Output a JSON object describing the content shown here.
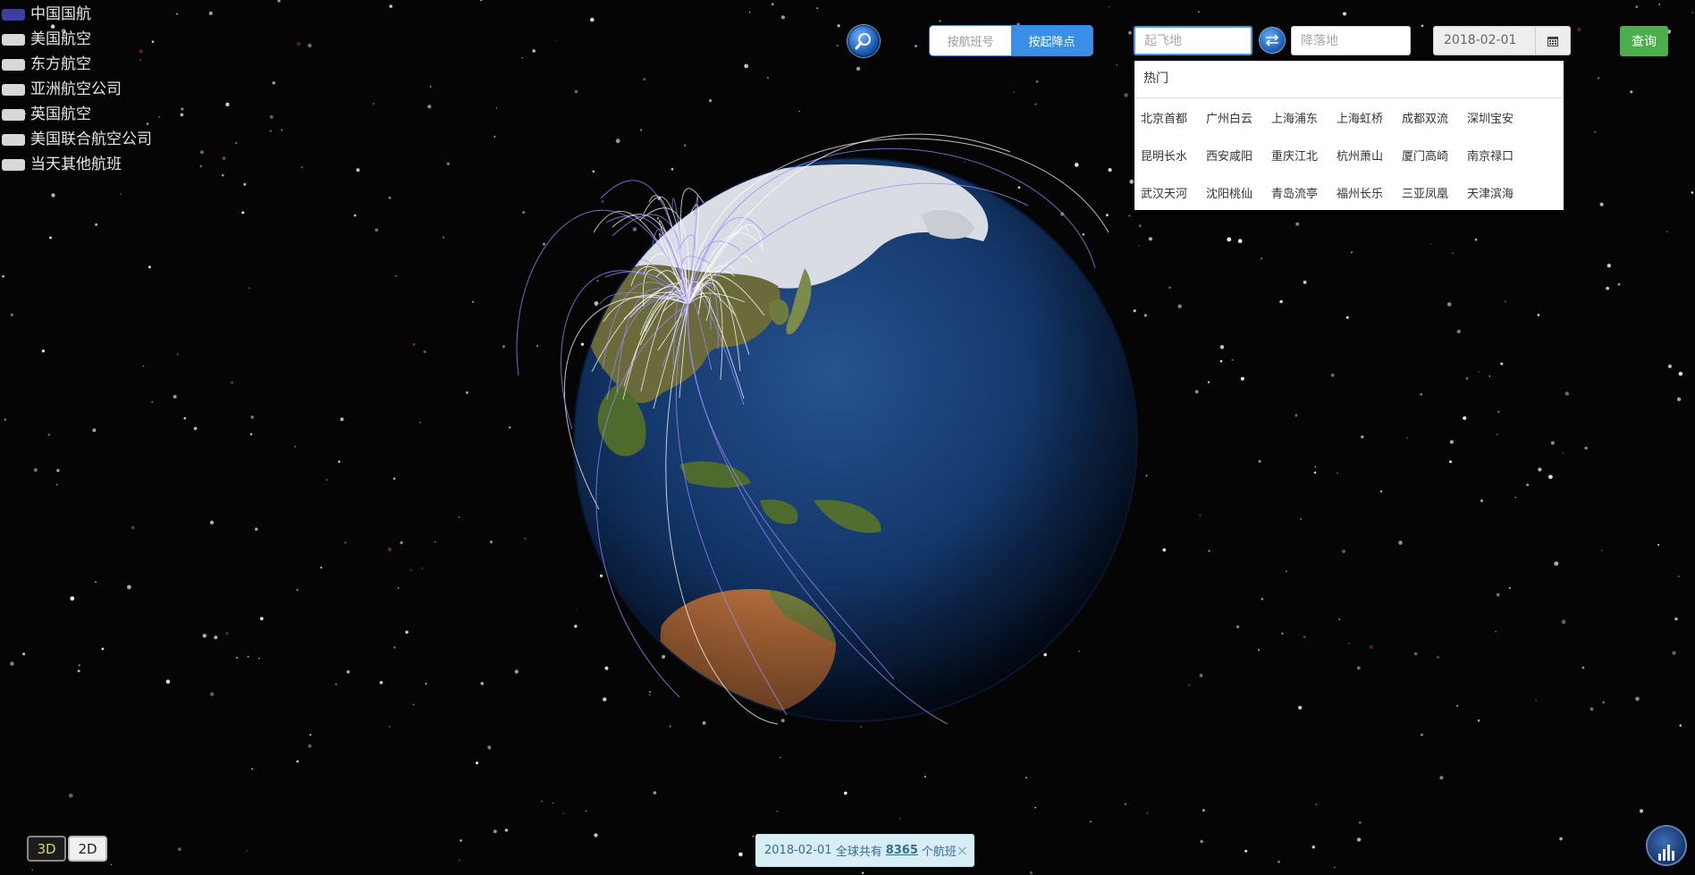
{
  "legend": {
    "items": [
      {
        "label": "中国国航",
        "color": "#3b3fa0",
        "active": true
      },
      {
        "label": "美国航空",
        "color": "#d8d8d8",
        "active": false
      },
      {
        "label": "东方航空",
        "color": "#d8d8d8",
        "active": false
      },
      {
        "label": "亚洲航空公司",
        "color": "#d8d8d8",
        "active": false
      },
      {
        "label": "英国航空",
        "color": "#d8d8d8",
        "active": false
      },
      {
        "label": "美国联合航空公司",
        "color": "#d8d8d8",
        "active": false
      },
      {
        "label": "当天其他航班",
        "color": "#d8d8d8",
        "active": false
      }
    ]
  },
  "toolbar": {
    "mode_flight_no": "按航班号",
    "mode_endpoints": "按起降点",
    "origin_placeholder": "起飞地",
    "destination_placeholder": "降落地",
    "date_value": "2018-02-01",
    "query_label": "查询"
  },
  "dropdown": {
    "header": "热门",
    "airports": [
      "北京首都",
      "广州白云",
      "上海浦东",
      "上海虹桥",
      "成都双流",
      "深圳宝安",
      "昆明长水",
      "西安咸阳",
      "重庆江北",
      "杭州萧山",
      "厦门高崎",
      "南京禄口",
      "武汉天河",
      "沈阳桃仙",
      "青岛流亭",
      "福州长乐",
      "三亚凤凰",
      "天津滨海"
    ]
  },
  "view_toggle": {
    "three_d": "3D",
    "two_d": "2D"
  },
  "notice": {
    "date": "2018-02-01",
    "prefix": "全球共有",
    "count": "8365",
    "suffix": "个航班",
    "close": "×"
  },
  "colors": {
    "route_line": "#9a8cff",
    "accent_blue": "#3b8ee6",
    "query_green": "#4cae4c"
  }
}
